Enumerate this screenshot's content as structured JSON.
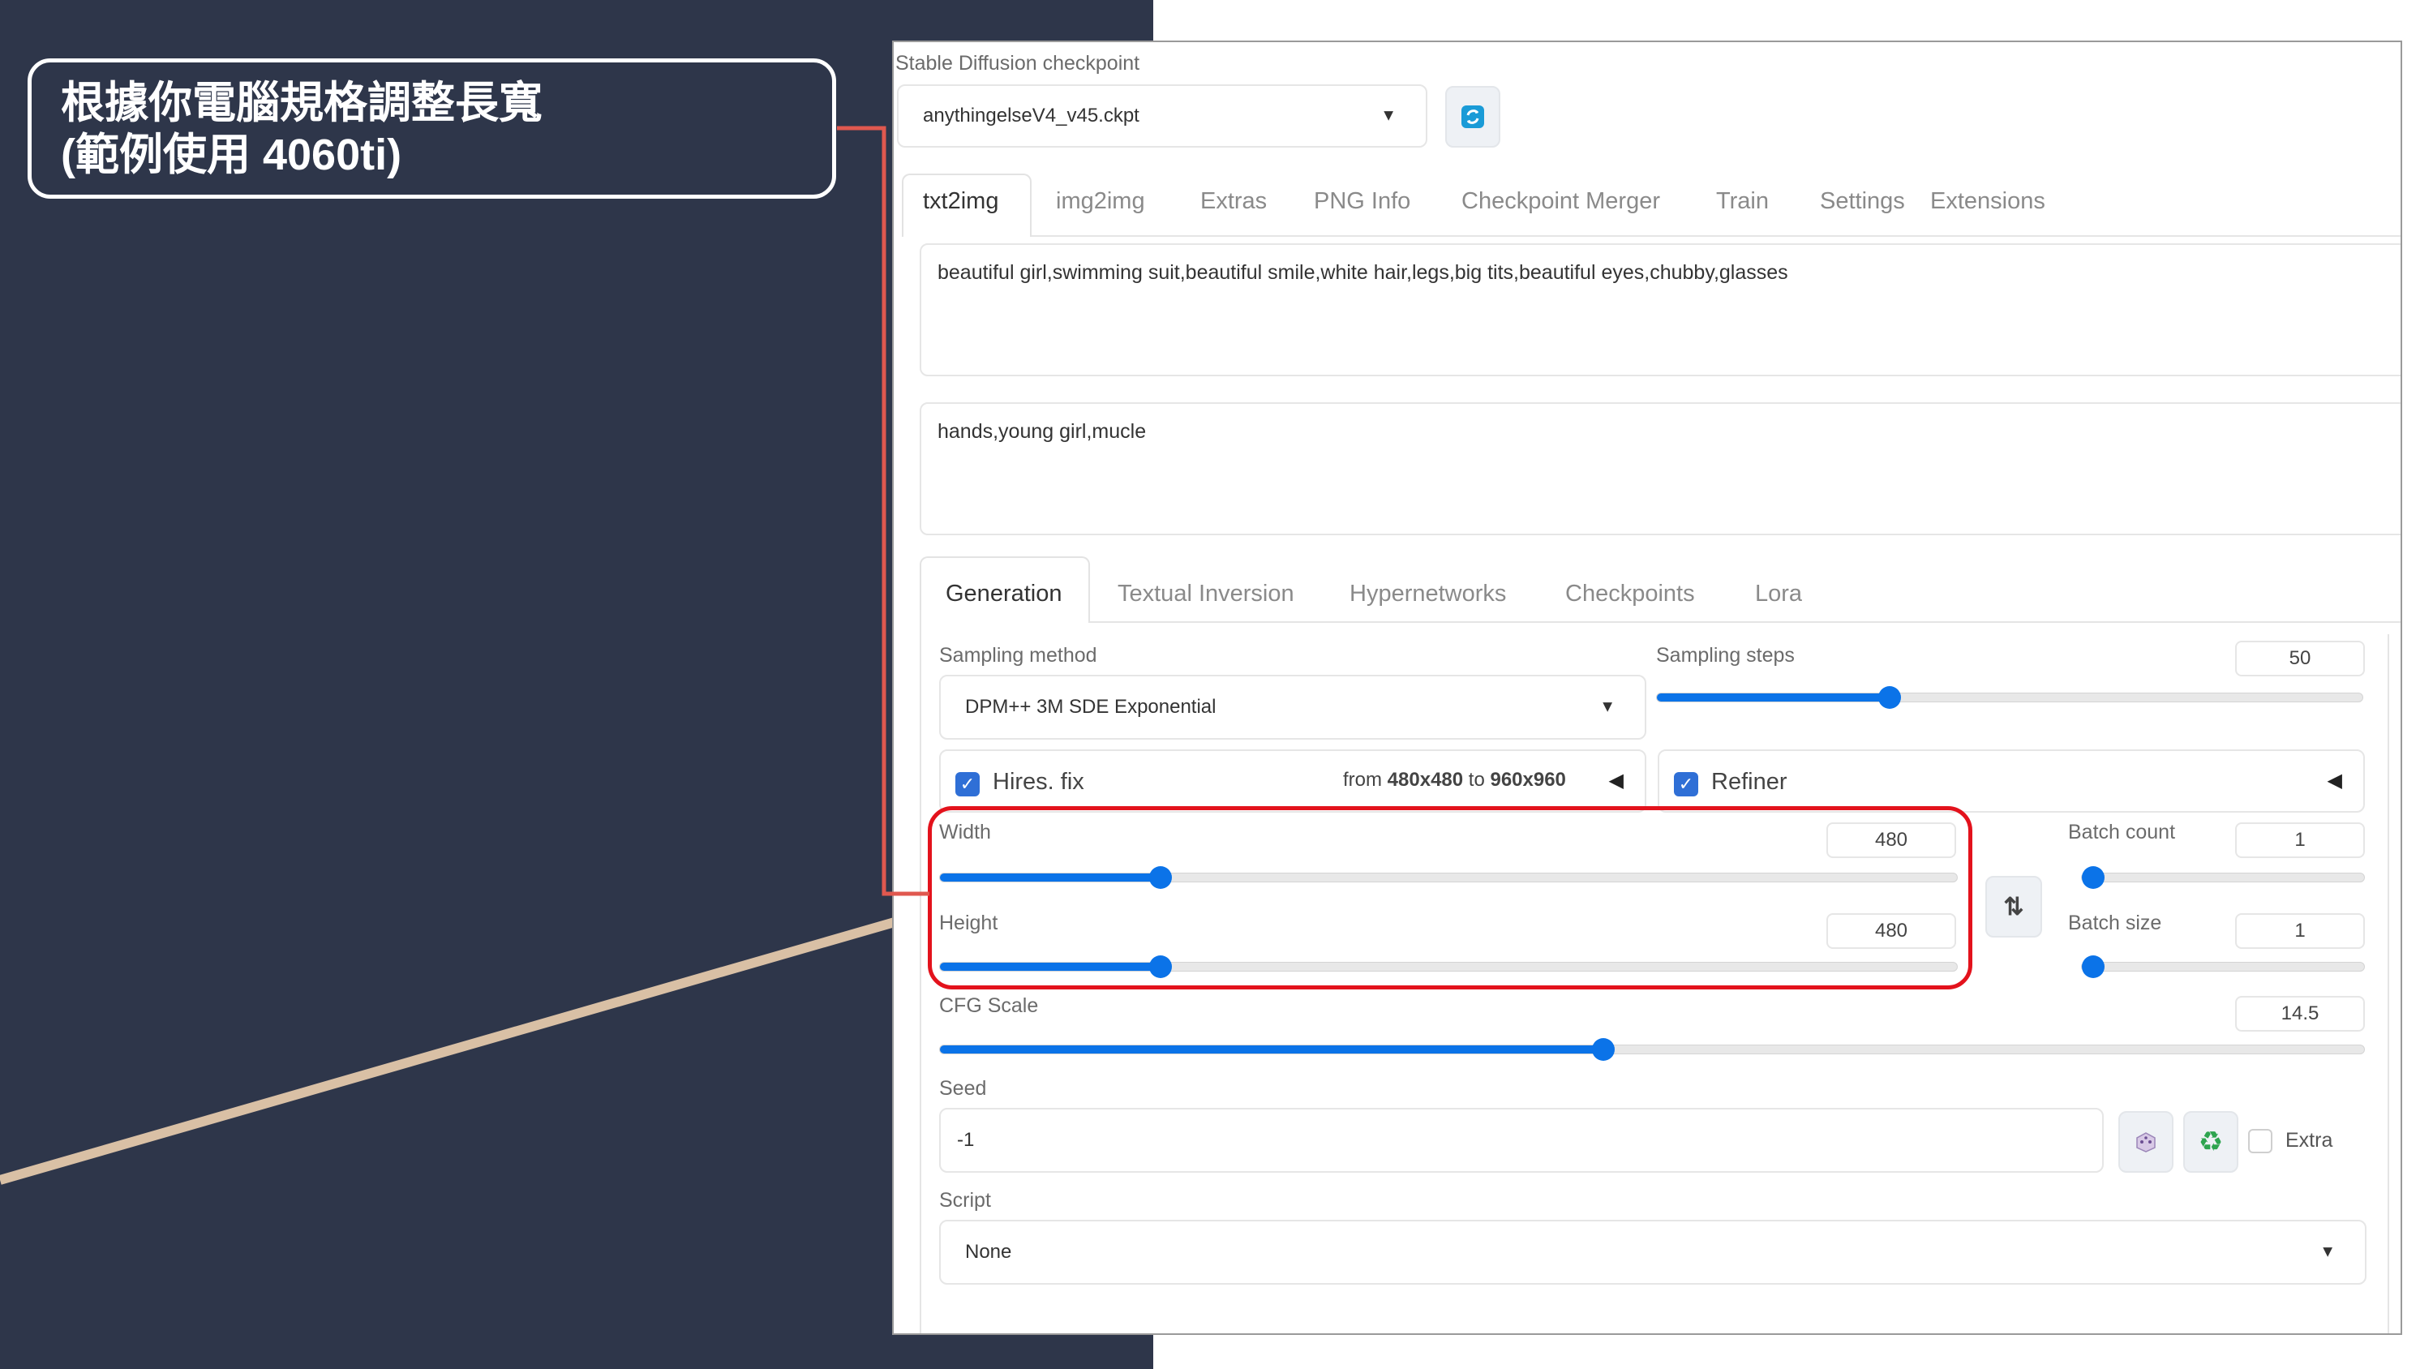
{
  "callout": {
    "line1": "根據你電腦規格調整長寬",
    "line2": "(範例使用 4060ti)"
  },
  "checkpoint": {
    "label": "Stable Diffusion checkpoint",
    "value": "anythingelseV4_v45.ckpt",
    "refresh_icon": "refresh-icon"
  },
  "main_tabs": [
    "txt2img",
    "img2img",
    "Extras",
    "PNG Info",
    "Checkpoint Merger",
    "Train",
    "Settings",
    "Extensions"
  ],
  "prompt": {
    "positive": "beautiful girl,swimming suit,beautiful smile,white hair,legs,big tits,beautiful eyes,chubby,glasses",
    "negative": "hands,young girl,mucle"
  },
  "sub_tabs": [
    "Generation",
    "Textual Inversion",
    "Hypernetworks",
    "Checkpoints",
    "Lora"
  ],
  "sampling": {
    "method_label": "Sampling method",
    "method_value": "DPM++ 3M SDE Exponential",
    "steps_label": "Sampling steps",
    "steps_value": "50",
    "steps_fraction": 0.33
  },
  "hires": {
    "label": "Hires. fix",
    "checked": true,
    "from_prefix": "from",
    "from_value": "480x480",
    "to_prefix": "to",
    "to_value": "960x960"
  },
  "refiner": {
    "label": "Refiner",
    "checked": true
  },
  "width": {
    "label": "Width",
    "value": "480",
    "fraction": 0.217
  },
  "height": {
    "label": "Height",
    "value": "480",
    "fraction": 0.217
  },
  "swap_icon": "swap-icon",
  "batch_count": {
    "label": "Batch count",
    "value": "1",
    "fraction": 0.0
  },
  "batch_size": {
    "label": "Batch size",
    "value": "1",
    "fraction": 0.0
  },
  "cfg": {
    "label": "CFG Scale",
    "value": "14.5",
    "fraction": 0.466
  },
  "seed": {
    "label": "Seed",
    "value": "-1",
    "dice_icon": "dice-icon",
    "recycle_icon": "recycle-icon",
    "extra_label": "Extra",
    "extra_checked": false
  },
  "script": {
    "label": "Script",
    "value": "None"
  },
  "colors": {
    "background_dark": "#2e364a",
    "accent_blue": "#0b73e8",
    "highlight_red": "#e3121c",
    "connector_red": "#e0584f",
    "diagonal_line": "#d9c0a5"
  }
}
